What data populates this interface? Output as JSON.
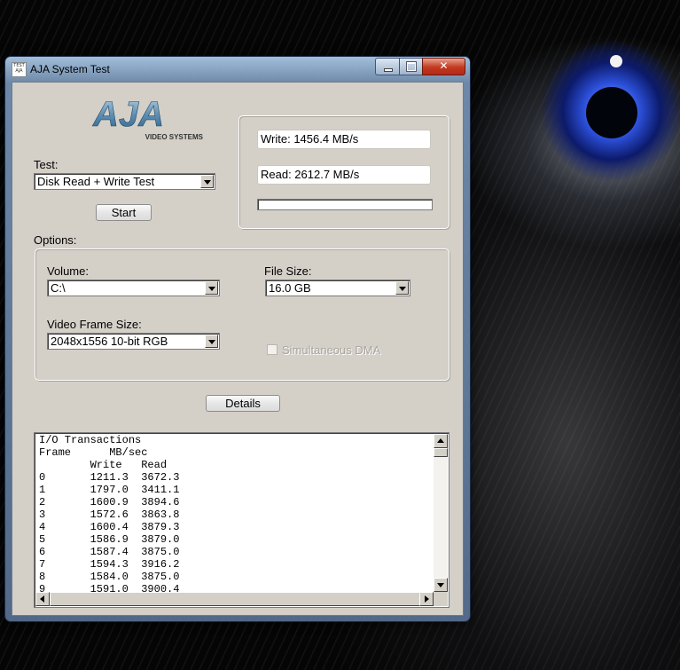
{
  "window": {
    "title": "AJA System Test",
    "app_icon_text": "TEST AJA"
  },
  "logo": {
    "brand": "AJA",
    "tagline": "VIDEO SYSTEMS"
  },
  "test": {
    "label": "Test:",
    "selected": "Disk Read + Write Test",
    "start_label": "Start"
  },
  "results": {
    "write": "Write: 1456.4 MB/s",
    "read": "Read: 2612.7 MB/s",
    "progress": 0
  },
  "options": {
    "label": "Options:",
    "volume_label": "Volume:",
    "volume_value": "C:\\",
    "file_size_label": "File Size:",
    "file_size_value": "16.0 GB",
    "frame_size_label": "Video Frame Size:",
    "frame_size_value": "2048x1556 10-bit RGB",
    "simultaneous_dma_label": "Simultaneous DMA",
    "simultaneous_dma_checked": false,
    "simultaneous_dma_enabled": false
  },
  "details_label": "Details",
  "io_log": {
    "lines": [
      "I/O Transactions",
      "Frame      MB/sec",
      "        Write   Read",
      "0       1211.3  3672.3",
      "1       1797.0  3411.1",
      "2       1600.9  3894.6",
      "3       1572.6  3863.8",
      "4       1600.4  3879.3",
      "5       1586.9  3879.0",
      "6       1587.4  3875.0",
      "7       1594.3  3916.2",
      "8       1584.0  3875.0",
      "9       1591.0  3900.4"
    ]
  }
}
